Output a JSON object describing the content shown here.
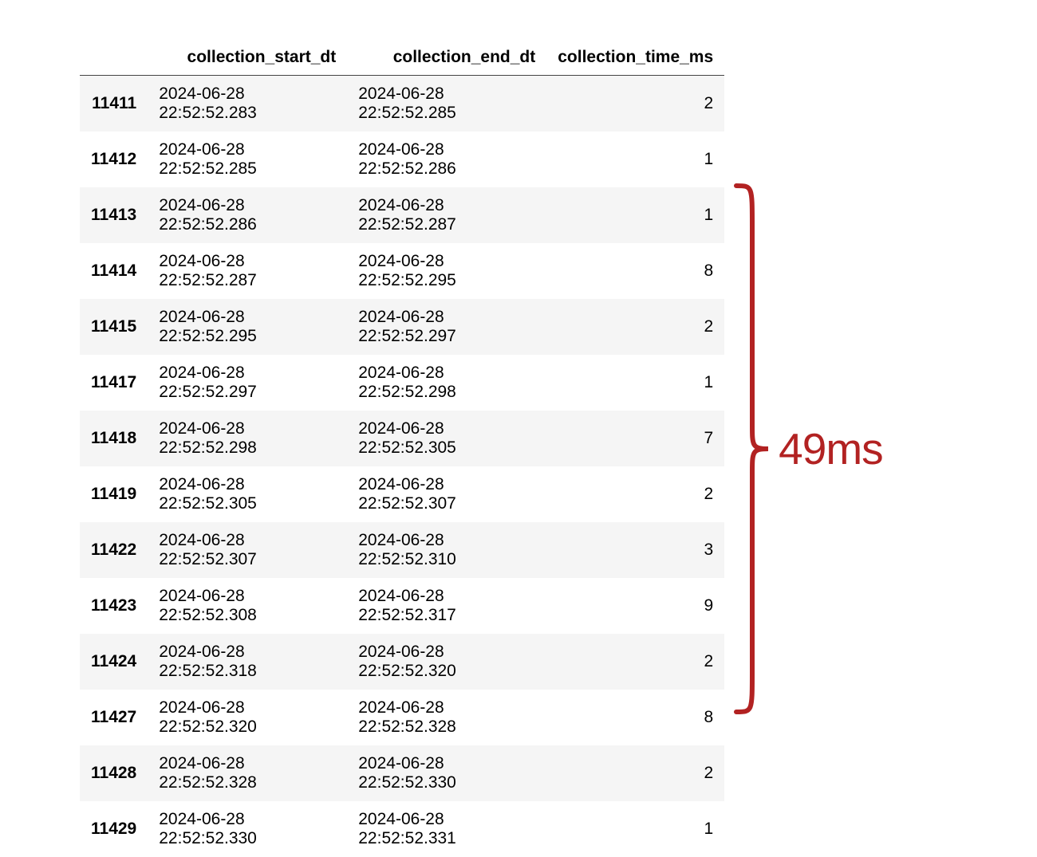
{
  "table": {
    "columns": {
      "index": "",
      "start": "collection_start_dt",
      "end": "collection_end_dt",
      "time": "collection_time_ms"
    },
    "rows": [
      {
        "index": "11411",
        "start": "2024-06-28 22:52:52.283",
        "end": "2024-06-28 22:52:52.285",
        "time": "2"
      },
      {
        "index": "11412",
        "start": "2024-06-28 22:52:52.285",
        "end": "2024-06-28 22:52:52.286",
        "time": "1"
      },
      {
        "index": "11413",
        "start": "2024-06-28 22:52:52.286",
        "end": "2024-06-28 22:52:52.287",
        "time": "1"
      },
      {
        "index": "11414",
        "start": "2024-06-28 22:52:52.287",
        "end": "2024-06-28 22:52:52.295",
        "time": "8"
      },
      {
        "index": "11415",
        "start": "2024-06-28 22:52:52.295",
        "end": "2024-06-28 22:52:52.297",
        "time": "2"
      },
      {
        "index": "11417",
        "start": "2024-06-28 22:52:52.297",
        "end": "2024-06-28 22:52:52.298",
        "time": "1"
      },
      {
        "index": "11418",
        "start": "2024-06-28 22:52:52.298",
        "end": "2024-06-28 22:52:52.305",
        "time": "7"
      },
      {
        "index": "11419",
        "start": "2024-06-28 22:52:52.305",
        "end": "2024-06-28 22:52:52.307",
        "time": "2"
      },
      {
        "index": "11422",
        "start": "2024-06-28 22:52:52.307",
        "end": "2024-06-28 22:52:52.310",
        "time": "3"
      },
      {
        "index": "11423",
        "start": "2024-06-28 22:52:52.308",
        "end": "2024-06-28 22:52:52.317",
        "time": "9"
      },
      {
        "index": "11424",
        "start": "2024-06-28 22:52:52.318",
        "end": "2024-06-28 22:52:52.320",
        "time": "2"
      },
      {
        "index": "11427",
        "start": "2024-06-28 22:52:52.320",
        "end": "2024-06-28 22:52:52.328",
        "time": "8"
      },
      {
        "index": "11428",
        "start": "2024-06-28 22:52:52.328",
        "end": "2024-06-28 22:52:52.330",
        "time": "2"
      },
      {
        "index": "11429",
        "start": "2024-06-28 22:52:52.330",
        "end": "2024-06-28 22:52:52.331",
        "time": "1"
      }
    ]
  },
  "annotation": {
    "label": "49ms",
    "color": "#b22222"
  }
}
